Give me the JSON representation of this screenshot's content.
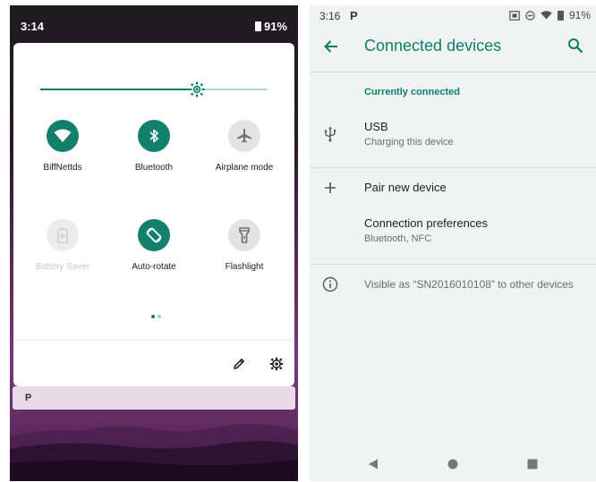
{
  "left_phone": {
    "status": {
      "time": "3:14",
      "battery": "91%"
    },
    "brightness_level": 0.69,
    "tiles": [
      {
        "label": "BiffNettds",
        "icon": "wifi-icon",
        "state": "on"
      },
      {
        "label": "Bluetooth",
        "icon": "bluetooth-icon",
        "state": "on"
      },
      {
        "label": "Airplane mode",
        "icon": "airplane-icon",
        "state": "off"
      },
      {
        "label": "Battery Saver",
        "icon": "battery-saver-icon",
        "state": "disabled"
      },
      {
        "label": "Auto-rotate",
        "icon": "auto-rotate-icon",
        "state": "on"
      },
      {
        "label": "Flashlight",
        "icon": "flashlight-icon",
        "state": "off"
      }
    ],
    "page_indicator": {
      "pages": 2,
      "current": 1
    },
    "notification": {
      "app_letter": "P"
    },
    "colors": {
      "accent": "#12806d",
      "tile_off": "#e3e3e3"
    }
  },
  "right_phone": {
    "status": {
      "time": "3:16",
      "app_letter": "P",
      "battery": "91%"
    },
    "appbar": {
      "title": "Connected devices"
    },
    "section_header": "Currently connected",
    "usb": {
      "title": "USB",
      "subtitle": "Charging this device",
      "icon": "usb-icon"
    },
    "pair": {
      "title": "Pair new device",
      "icon": "plus-icon"
    },
    "preferences": {
      "title": "Connection preferences",
      "subtitle": "Bluetooth, NFC"
    },
    "info": {
      "text": "Visible as “SN2016010108” to other devices",
      "icon": "info-icon"
    },
    "colors": {
      "accent": "#0b7e6b"
    }
  }
}
